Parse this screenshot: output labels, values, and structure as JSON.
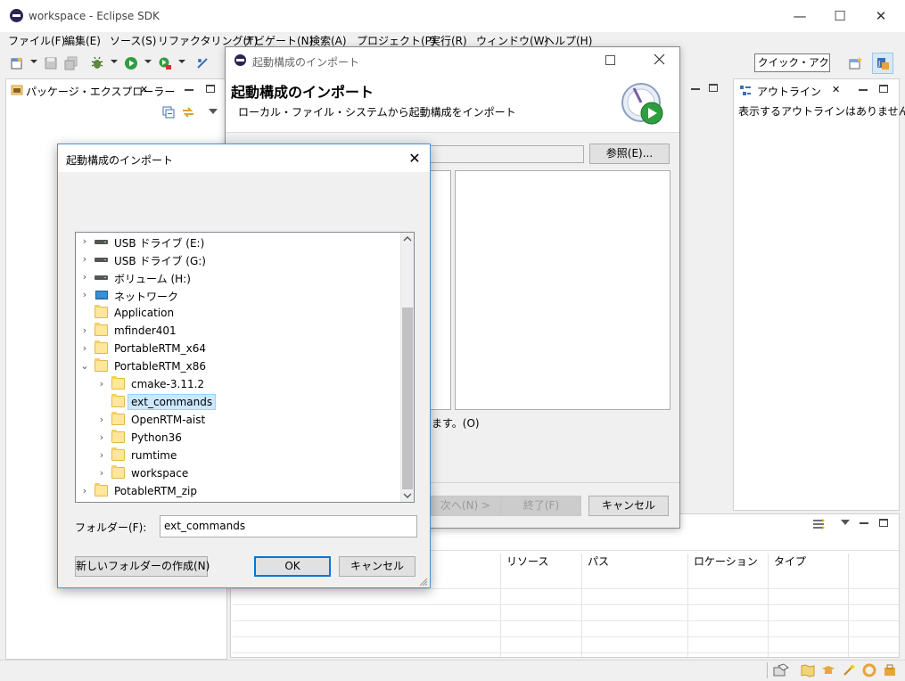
{
  "main_window": {
    "title": "workspace - Eclipse SDK",
    "minimize": "—",
    "maximize": "☐",
    "close": "✕"
  },
  "menubar": [
    {
      "label": "ファイル(F)"
    },
    {
      "label": "編集(E)"
    },
    {
      "label": "ソース(S)"
    },
    {
      "label": "リファクタリング(T)"
    },
    {
      "label": "ナビゲート(N)"
    },
    {
      "label": "検索(A)"
    },
    {
      "label": "プロジェクト(P)"
    },
    {
      "label": "実行(R)"
    },
    {
      "label": "ウィンドウ(W)"
    },
    {
      "label": "ヘルプ(H)"
    }
  ],
  "toolbar": {
    "quick_access": "クイック・アクセス"
  },
  "package_explorer": {
    "tab_label": "パッケージ・エクスプローラー",
    "close_glyph": "✕"
  },
  "outline": {
    "tab_label": "アウトライン",
    "close_glyph": "✕",
    "message": "表示するアウトラインはありません。"
  },
  "bottom_view": {
    "columns": [
      "リソース",
      "パス",
      "ロケーション",
      "タイプ"
    ]
  },
  "wizard": {
    "title": "起動構成のインポート",
    "header_title": "起動構成のインポート",
    "header_description": "ローカル・ファイル・システムから起動構成をインポート",
    "browse_button": "参照(E)...",
    "partial_option_text": "ます。(O)",
    "next_button": "次へ(N) >",
    "finish_button": "終了(F)",
    "cancel_button": "キャンセル"
  },
  "folder_dialog": {
    "title": "起動構成のインポート",
    "close_glyph": "✕",
    "tree": [
      {
        "label": "USB ドライブ (E:)",
        "icon": "drive-icon",
        "depth": 0,
        "expander": "collapsed"
      },
      {
        "label": "USB ドライブ (G:)",
        "icon": "drive-icon",
        "depth": 0,
        "expander": "collapsed"
      },
      {
        "label": "ボリューム (H:)",
        "icon": "drive-icon",
        "depth": 0,
        "expander": "collapsed"
      },
      {
        "label": "ネットワーク",
        "icon": "network-icon",
        "depth": 0,
        "expander": "collapsed"
      },
      {
        "label": "Application",
        "icon": "folder-icon",
        "depth": 0,
        "expander": "none"
      },
      {
        "label": "mfinder401",
        "icon": "folder-icon",
        "depth": 0,
        "expander": "collapsed"
      },
      {
        "label": "PortableRTM_x64",
        "icon": "folder-icon",
        "depth": 0,
        "expander": "collapsed"
      },
      {
        "label": "PortableRTM_x86",
        "icon": "folder-icon",
        "depth": 0,
        "expander": "expanded"
      },
      {
        "label": "cmake-3.11.2",
        "icon": "folder-icon",
        "depth": 1,
        "expander": "collapsed"
      },
      {
        "label": "ext_commands",
        "icon": "folder-icon",
        "depth": 1,
        "expander": "none",
        "selected": true
      },
      {
        "label": "OpenRTM-aist",
        "icon": "folder-icon",
        "depth": 1,
        "expander": "collapsed"
      },
      {
        "label": "Python36",
        "icon": "folder-icon",
        "depth": 1,
        "expander": "collapsed"
      },
      {
        "label": "rumtime",
        "icon": "folder-icon",
        "depth": 1,
        "expander": "collapsed"
      },
      {
        "label": "workspace",
        "icon": "folder-icon",
        "depth": 1,
        "expander": "collapsed"
      },
      {
        "label": "PotableRTM_zip",
        "icon": "folder-icon",
        "depth": 0,
        "expander": "collapsed"
      }
    ],
    "folder_label": "フォルダー(F):",
    "folder_value": "ext_commands",
    "new_folder_button": "新しいフォルダーの作成(N)",
    "ok_button": "OK",
    "cancel_button": "キャンセル"
  }
}
